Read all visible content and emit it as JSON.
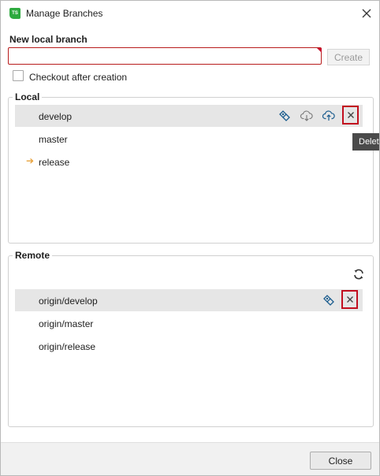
{
  "window": {
    "title": "Manage Branches",
    "app_badge": "TS"
  },
  "new_branch": {
    "label": "New local branch",
    "value": "",
    "placeholder": "",
    "create_label": "Create",
    "checkout_label": "Checkout after creation",
    "checkout_checked": false
  },
  "local": {
    "title": "Local",
    "branches": [
      {
        "name": "develop",
        "selected": true,
        "current": false
      },
      {
        "name": "master",
        "selected": false,
        "current": false
      },
      {
        "name": "release",
        "selected": false,
        "current": true
      }
    ],
    "current_marker": "➔"
  },
  "remote": {
    "title": "Remote",
    "branches": [
      {
        "name": "origin/develop",
        "selected": true
      },
      {
        "name": "origin/master",
        "selected": false
      },
      {
        "name": "origin/release",
        "selected": false
      }
    ]
  },
  "tooltip": {
    "text": "Delete"
  },
  "footer": {
    "close_label": "Close"
  },
  "icons": {
    "merge": "merge-icon",
    "pull": "pull-icon",
    "push": "push-icon",
    "delete": "delete-icon",
    "refresh": "refresh-icon",
    "close": "close-icon"
  },
  "colors": {
    "accent_red": "#c20f1f",
    "selection": "#e6e6e6",
    "current_arrow": "#e8a33d",
    "icon_blue": "#1a5c8e",
    "app_green": "#2eaa3f"
  }
}
